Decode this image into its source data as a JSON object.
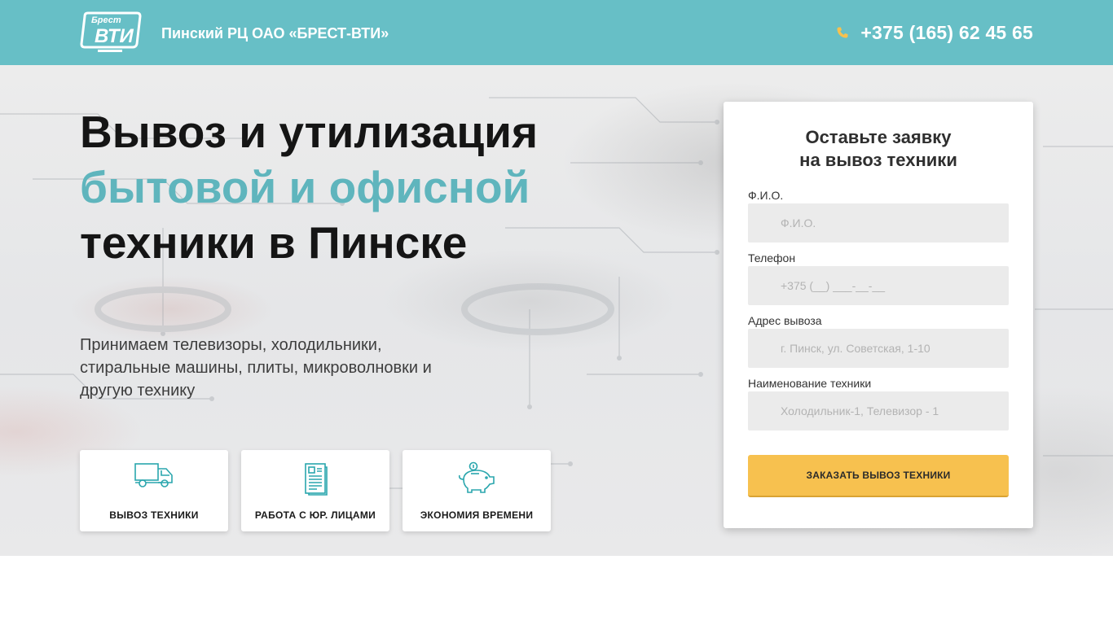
{
  "header": {
    "logo_text_top": "Брест",
    "logo_text_main": "ВТИ",
    "company_name": "Пинский РЦ ОАО «БРЕСТ-ВТИ»",
    "phone": "+375 (165) 62 45 65",
    "background_color": "#67bfc6",
    "phone_icon_color": "#f7c14f"
  },
  "hero": {
    "title_line1": "Вывоз и утилизация",
    "title_line2": "бытовой и офисной",
    "title_line3": "техники в Пинске",
    "accent_color": "#5fb5bd",
    "subtitle": "Принимаем телевизоры, холодильники, стиральные машины, плиты, микроволновки и другую технику"
  },
  "features": [
    {
      "icon": "truck-icon",
      "label": "ВЫВОЗ ТЕХНИКИ"
    },
    {
      "icon": "document-icon",
      "label": "РАБОТА С ЮР. ЛИЦАМИ"
    },
    {
      "icon": "piggy-bank-icon",
      "label": "ЭКОНОМИЯ ВРЕМЕНИ"
    }
  ],
  "form": {
    "title_line1": "Оставьте заявку",
    "title_line2": "на вывоз техники",
    "fields": [
      {
        "label": "Ф.И.О.",
        "placeholder": "Ф.И.О.",
        "value": ""
      },
      {
        "label": "Телефон",
        "placeholder": "+375 (__) ___-__-__",
        "value": ""
      },
      {
        "label": "Адрес вывоза",
        "placeholder": "г. Пинск, ул. Советская, 1-10",
        "value": ""
      },
      {
        "label": "Наименование техники",
        "placeholder": "Холодильник-1, Телевизор - 1",
        "value": ""
      }
    ],
    "submit_label": "ЗАКАЗАТЬ ВЫВОЗ ТЕХНИКИ",
    "submit_color": "#f7c14f"
  }
}
